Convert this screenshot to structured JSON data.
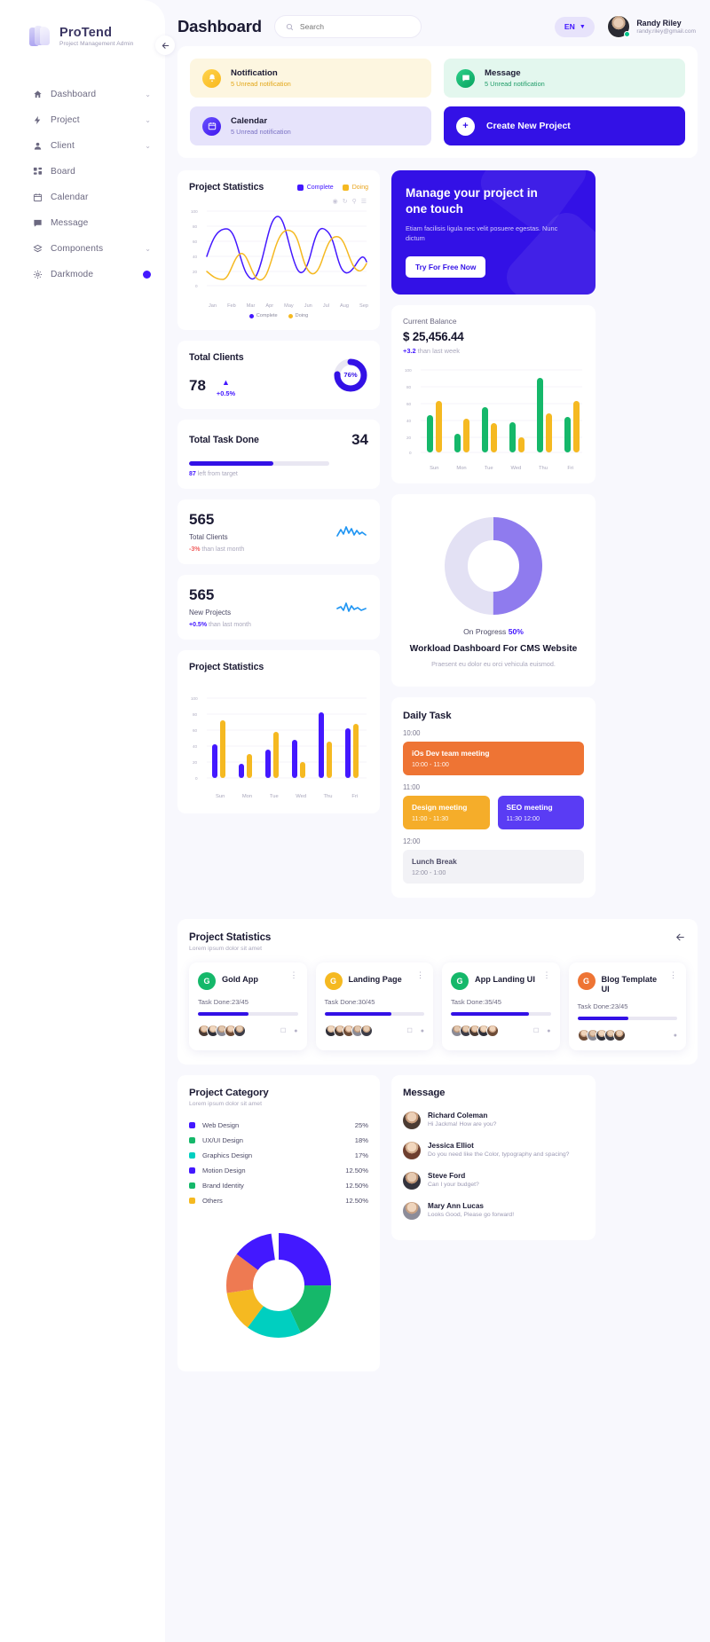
{
  "brand": {
    "name": "ProTend",
    "subtitle": "Project Management Admin",
    "logo_icon": "layers-logo-icon"
  },
  "sidebar": {
    "collapse_icon": "arrow-left-icon",
    "items": [
      {
        "label": "Dashboard",
        "icon": "home-icon",
        "chevron": "⌄"
      },
      {
        "label": "Project",
        "icon": "bolt-icon",
        "chevron": "⌄"
      },
      {
        "label": "Client",
        "icon": "user-icon",
        "chevron": "⌄"
      },
      {
        "label": "Board",
        "icon": "grid-icon",
        "chevron": ""
      },
      {
        "label": "Calendar",
        "icon": "calendar-icon",
        "chevron": ""
      },
      {
        "label": "Message",
        "icon": "chat-icon",
        "chevron": ""
      },
      {
        "label": "Components",
        "icon": "layers-icon",
        "chevron": "⌄"
      },
      {
        "label": "Darkmode",
        "icon": "gear-icon",
        "chevron": ""
      }
    ]
  },
  "header": {
    "title": "Dashboard",
    "search": {
      "placeholder": "Search",
      "value": "",
      "icon": "search-icon"
    },
    "language": {
      "label": "EN",
      "caret": "▼"
    },
    "user": {
      "name": "Randy Riley",
      "email": "randy.riley@gmail.com",
      "status": "online"
    }
  },
  "widgets": [
    {
      "title": "Notification",
      "subtitle": "5 Unread notification",
      "icon": "bell-icon",
      "style": "yellow"
    },
    {
      "title": "Message",
      "subtitle": "5 Unread notification",
      "icon": "chat-icon",
      "style": "green"
    },
    {
      "title": "Calendar",
      "subtitle": "5 Unread notification",
      "icon": "calendar-icon",
      "style": "violet"
    },
    {
      "title": "Create New Project",
      "subtitle": "",
      "icon": "plus-icon",
      "style": "solid"
    }
  ],
  "project_statistics_line": {
    "title": "Project Statistics",
    "legend": [
      {
        "label": "Complete",
        "color": "#4318ff"
      },
      {
        "label": "Doing",
        "color": "#f5b921"
      }
    ],
    "tools": [
      "eye-icon",
      "refresh-icon",
      "search-icon",
      "menu-icon"
    ]
  },
  "total_clients_ring": {
    "title": "Total Clients",
    "value": "78",
    "delta": "+0.5%",
    "trend_icon": "triangle-up-icon",
    "ring_value": "76%",
    "ring_percent": 76
  },
  "total_task_done": {
    "title": "Total Task Done",
    "value": "34",
    "progress_percent": 60,
    "note_value": "87",
    "note_text": "left from target"
  },
  "mini_stats": [
    {
      "value": "565",
      "label": "Total Clients",
      "delta": "-3%",
      "delta_suffix": "than last month",
      "direction": "down",
      "spark": "spark-line-icon"
    },
    {
      "value": "565",
      "label": "New Projects",
      "delta": "+0.5%",
      "delta_suffix": "than last month",
      "direction": "up",
      "spark": "spark-line-icon"
    }
  ],
  "project_statistics_bar": {
    "title": "Project Statistics"
  },
  "promo": {
    "heading": "Manage your project in one touch",
    "body": "Etiam facilisis ligula nec velit posuere egestas. Nunc dictum",
    "cta": "Try For Free Now"
  },
  "current_balance": {
    "label": "Current Balance",
    "amount": "$ 25,456.44",
    "delta": "+3.2",
    "delta_suffix": "than last week"
  },
  "workload": {
    "progress_label": "On Progress",
    "progress_value": "50%",
    "title": "Workload Dashboard For CMS Website",
    "subtitle": "Praesent eu dolor eu orci vehicula euismod."
  },
  "daily_task": {
    "title": "Daily Task",
    "groups": [
      {
        "time": "10:00",
        "tasks": [
          {
            "name": "iOs Dev team meeting",
            "range": "10:00 - 11:00",
            "style": "orange"
          }
        ]
      },
      {
        "time": "11:00",
        "tasks": [
          {
            "name": "Design meeting",
            "range": "11:00 - 11:30",
            "style": "amber"
          },
          {
            "name": "SEO meeting",
            "range": "11:30 12:00",
            "style": "violet"
          }
        ]
      },
      {
        "time": "12:00",
        "tasks": [
          {
            "name": "Lunch Break",
            "range": "12:00 - 1:00",
            "style": "grey"
          }
        ]
      }
    ]
  },
  "project_section": {
    "title": "Project Statistics",
    "subtitle": "Lorem ipsum dolor sit amet",
    "back_icon": "arrow-left-icon",
    "cards": [
      {
        "badge": "G",
        "badge_color": "#15b86a",
        "name": "Gold App",
        "task": "Task Done:23/45",
        "percent": 51,
        "menu_icon": "kebab-icon"
      },
      {
        "badge": "G",
        "badge_color": "#f5b921",
        "name": "Landing Page",
        "task": "Task Done:30/45",
        "percent": 67,
        "menu_icon": "kebab-icon"
      },
      {
        "badge": "G",
        "badge_color": "#15b86a",
        "name": "App Landing UI",
        "task": "Task Done:35/45",
        "percent": 78,
        "menu_icon": "kebab-icon"
      },
      {
        "badge": "G",
        "badge_color": "#ee7434",
        "name": "Blog Template UI",
        "task": "Task Done:23/45",
        "percent": 51,
        "menu_icon": "kebab-icon"
      }
    ]
  },
  "project_category": {
    "title": "Project Category",
    "subtitle": "Lorem ipsum dolor sit amet",
    "rows": [
      {
        "label": "Web Design",
        "value": "25%",
        "color": "#4318ff"
      },
      {
        "label": "UX/UI Design",
        "value": "18%",
        "color": "#15b86a"
      },
      {
        "label": "Graphics Design",
        "value": "17%",
        "color": "#00cfc0"
      },
      {
        "label": "Motion Design",
        "value": "12.50%",
        "color": "#4318ff"
      },
      {
        "label": "Brand Identity",
        "value": "12.50%",
        "color": "#15b86a"
      },
      {
        "label": "Others",
        "value": "12.50%",
        "color": "#f5b921"
      }
    ]
  },
  "messages": {
    "title": "Message",
    "items": [
      {
        "name": "Richard Coleman",
        "text": "Hi Jackma! How are you?"
      },
      {
        "name": "Jessica Elliot",
        "text": "Do you need like the Color, typography and spacing?"
      },
      {
        "name": "Steve Ford",
        "text": "Can I your budget?"
      },
      {
        "name": "Mary Ann Lucas",
        "text": "Looks Good, Please go forward!"
      }
    ]
  },
  "chart_data": [
    {
      "type": "line",
      "title": "Project Statistics",
      "x": [
        "Jan",
        "Feb",
        "Mar",
        "Apr",
        "May",
        "Jun",
        "Jul",
        "Aug",
        "Sep"
      ],
      "ylim": [
        0,
        100
      ],
      "yticks": [
        0,
        20,
        40,
        60,
        80,
        100
      ],
      "grid": true,
      "legend": [
        "Complete",
        "Doing"
      ],
      "legend_position": "bottom",
      "series": [
        {
          "name": "Complete",
          "color": "#4318ff",
          "values": [
            40,
            70,
            22,
            92,
            30,
            80,
            38,
            62,
            26
          ]
        },
        {
          "name": "Doing",
          "color": "#f5b921",
          "values": [
            20,
            14,
            46,
            12,
            76,
            30,
            14,
            74,
            34
          ]
        }
      ]
    },
    {
      "type": "bar",
      "title": "Current Balance",
      "categories": [
        "Sun",
        "Mon",
        "Tue",
        "Wed",
        "Thu",
        "Fri"
      ],
      "ylim": [
        0,
        100
      ],
      "yticks": [
        0,
        20,
        40,
        60,
        80,
        100
      ],
      "grid": true,
      "series": [
        {
          "name": "Green",
          "color": "#15b86a",
          "values": [
            45,
            22,
            54,
            36,
            88,
            42
          ]
        },
        {
          "name": "Yellow",
          "color": "#f5b921",
          "values": [
            62,
            40,
            35,
            18,
            60,
            70
          ]
        }
      ]
    },
    {
      "type": "bar",
      "title": "Project Statistics",
      "categories": [
        "Sun",
        "Mon",
        "Tue",
        "Wed",
        "Thu",
        "Fri"
      ],
      "ylim": [
        0,
        100
      ],
      "yticks": [
        0,
        20,
        40,
        60,
        80,
        100
      ],
      "grid": true,
      "series": [
        {
          "name": "Blue",
          "color": "#4318ff",
          "values": [
            42,
            18,
            35,
            48,
            82,
            62
          ]
        },
        {
          "name": "Yellow",
          "color": "#f5b921",
          "values": [
            72,
            30,
            58,
            20,
            45,
            68
          ]
        }
      ]
    },
    {
      "type": "pie",
      "title": "Workload Dashboard For CMS Website",
      "donut": true,
      "labels": [
        "On Progress",
        "Remaining"
      ],
      "values": [
        50,
        50
      ],
      "colors": [
        "#8f7bee",
        "#e3e1f4"
      ]
    },
    {
      "type": "pie",
      "title": "Project Category",
      "donut": true,
      "labels": [
        "Web Design",
        "UX/UI Design",
        "Graphics Design",
        "Motion Design",
        "Brand Identity",
        "Others"
      ],
      "values": [
        25,
        18,
        17,
        12.5,
        12.5,
        12.5
      ],
      "colors": [
        "#4318ff",
        "#15b86a",
        "#00cfc0",
        "#4318ff",
        "#ee7a52",
        "#f5b921"
      ]
    },
    {
      "type": "pie",
      "title": "Total Clients",
      "donut": true,
      "labels": [
        "Complete",
        "Remaining"
      ],
      "values": [
        76,
        24
      ],
      "colors": [
        "#3311e6",
        "#e9e7f2"
      ]
    }
  ]
}
